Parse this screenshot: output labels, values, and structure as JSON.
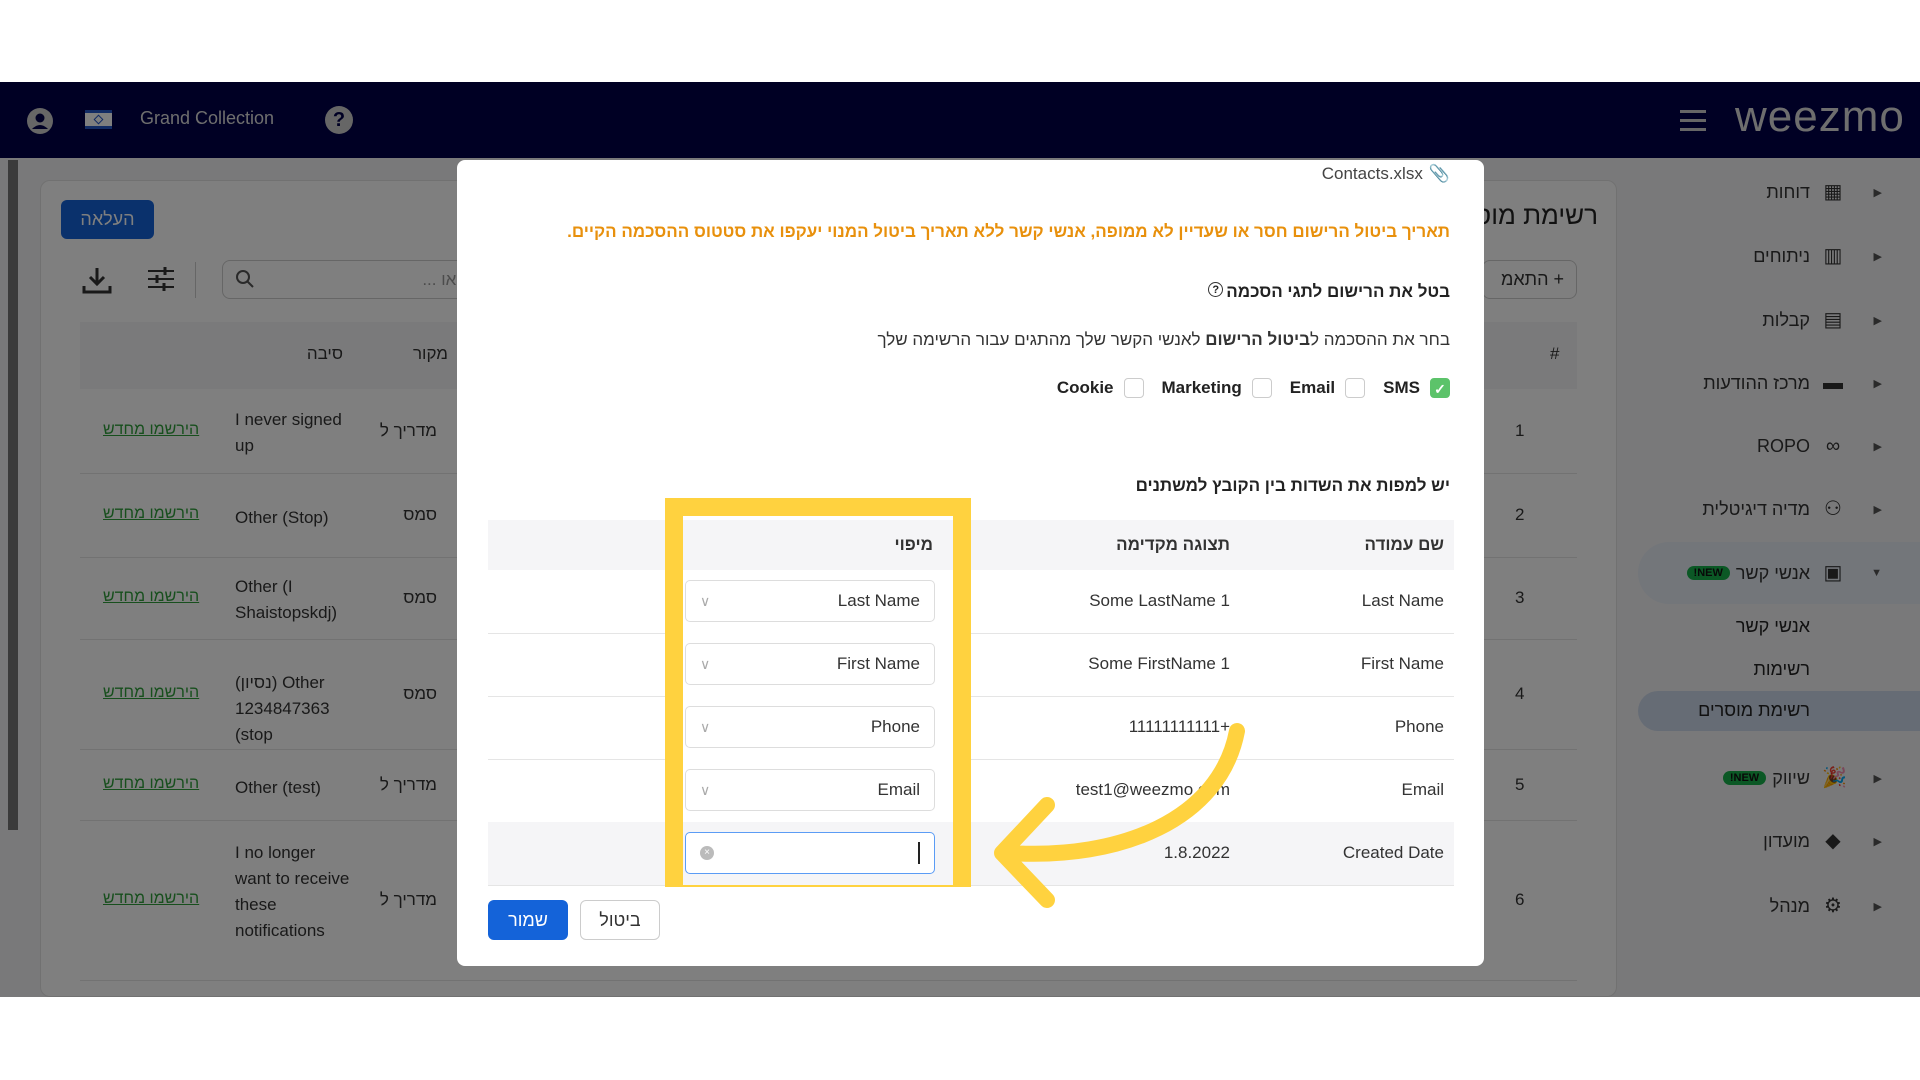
{
  "navbar": {
    "store_name": "Grand Collection",
    "logo": "weezmo",
    "icons": [
      "user-icon",
      "israel-flag-icon",
      "help-icon",
      "hamburger-icon"
    ]
  },
  "list_page": {
    "title": "רשימת מוסרים",
    "upload_label": "העלאה",
    "add_label": "התאמ",
    "search_placeholder": "חיפוש לפי שם, דו\"אל או ...",
    "columns": [
      "#",
      "מקור",
      "סיבה",
      ""
    ],
    "rows": [
      {
        "num": "1",
        "source": "מדריך ל",
        "reason": "I never signed up",
        "action": "הירשמו מחדש"
      },
      {
        "num": "2",
        "source": "סמס",
        "reason": "Other (Stop)",
        "action": "הירשמו מחדש"
      },
      {
        "num": "3",
        "source": "סמס",
        "reason": "Other (I Shaistopskdj)",
        "action": "הירשמו מחדש"
      },
      {
        "num": "4",
        "source": "סמס",
        "reason": "(נסיון) Other 1234847363 (stop",
        "action": "הירשמו מחדש"
      },
      {
        "num": "5",
        "source": "מדריך ל",
        "reason": "Other (test)",
        "action": "הירשמו מחדש"
      },
      {
        "num": "6",
        "source": "מדריך ל",
        "reason": "I no longer want to receive these notifications",
        "action": "הירשמו מחדש"
      }
    ]
  },
  "sidebar": {
    "items": [
      {
        "label": "דוחות",
        "icon": "dashboard-icon"
      },
      {
        "label": "ניתוחים",
        "icon": "bar-chart-icon"
      },
      {
        "label": "קבלות",
        "icon": "receipt-icon"
      },
      {
        "label": "מרכז ההודעות",
        "icon": "message-icon"
      },
      {
        "label": "ROPO",
        "icon": "infinity-icon"
      },
      {
        "label": "מדיה דיגיטלית",
        "icon": "people-icon"
      },
      {
        "label": "אנשי קשר",
        "icon": "contact-card-icon",
        "badge": "NEW!",
        "expanded": true
      },
      {
        "label": "שיווק",
        "icon": "party-popper-icon",
        "badge": "NEW!"
      },
      {
        "label": "מועדון",
        "icon": "tag-icon"
      },
      {
        "label": "מנהל",
        "icon": "gear-icon"
      }
    ],
    "subitems": [
      {
        "label": "אנשי קשר"
      },
      {
        "label": "רשימות"
      },
      {
        "label": "רשימת מוסרים",
        "active": true
      }
    ]
  },
  "modal": {
    "file_name": "Contacts.xlsx",
    "warning": "תאריך ביטול הרישום חסר או שעדיין לא ממופה, אנשי קשר ללא תאריך ביטול המנוי יעקפו את סטטוס ההסכמה הקיים.",
    "heading": "בטל את הרישום לתגי הסכמה",
    "description_pre": "בחר את ההסכמה ל",
    "description_bold": "ביטול הרישום",
    "description_post": " לאנשי הקשר שלך מהתגים עבור הרשימה שלך",
    "consents": [
      {
        "label": "SMS",
        "checked": true
      },
      {
        "label": "Email",
        "checked": false
      },
      {
        "label": "Marketing",
        "checked": false
      },
      {
        "label": "Cookie",
        "checked": false
      }
    ],
    "mapping_title": "יש למפות את השדות בין הקובץ למשתנים",
    "table_headers": [
      "שם עמודה",
      "תצוגה מקדימה",
      "מיפוי"
    ],
    "rows": [
      {
        "column": "Last Name",
        "preview": "Some LastName 1",
        "mapping": "Last Name"
      },
      {
        "column": "First Name",
        "preview": "Some FirstName 1",
        "mapping": "First Name"
      },
      {
        "column": "Phone",
        "preview": "11111111111+",
        "mapping": "Phone"
      },
      {
        "column": "Email",
        "preview": "test1@weezmo.com",
        "mapping": "Email"
      },
      {
        "column": "Created Date",
        "preview": "1.8.2022",
        "mapping": ""
      }
    ],
    "save_label": "שמור",
    "cancel_label": "ביטול"
  },
  "colors": {
    "navbar": "#000048",
    "primary": "#1463d9",
    "warning": "#e8900c",
    "highlight": "#ffd23f",
    "link": "#2e9e3a",
    "badge": "#16b04a"
  }
}
